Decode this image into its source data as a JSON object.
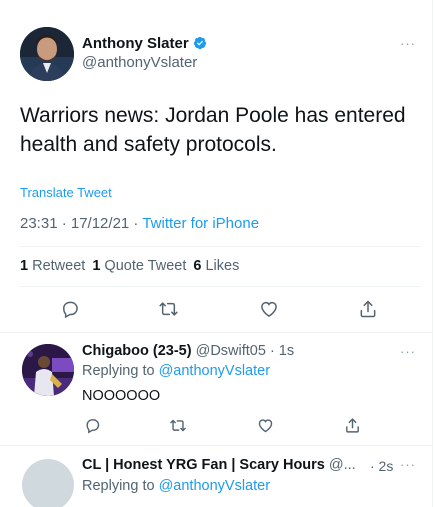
{
  "main_tweet": {
    "author_name": "Anthony Slater",
    "author_handle": "@anthonyVslater",
    "verified": true,
    "more_label": "···",
    "text": "Warriors news: Jordan Poole has entered health and safety protocols.",
    "translate_label": "Translate Tweet",
    "time": "23:31 · 17/12/21 · ",
    "source": "Twitter for iPhone",
    "stats": {
      "retweets_count": "1",
      "retweets_label": "Retweet",
      "quotes_count": "1",
      "quotes_label": "Quote Tweet",
      "likes_count": "6",
      "likes_label": "Likes"
    },
    "actions": [
      "reply-icon",
      "retweet-icon",
      "like-icon",
      "share-icon"
    ]
  },
  "replies": [
    {
      "name": "Chigaboo (23-5)",
      "handle": "@Dswift05",
      "time": "· 1s",
      "replying_prefix": "Replying to ",
      "replying_to": "@anthonyVslater",
      "text": "NOOOOOO",
      "more_label": "···"
    },
    {
      "name": "CL | Honest YRG Fan | Scary Hours",
      "handle": "@...",
      "time": "· 2s",
      "replying_prefix": "Replying to ",
      "replying_to": "@anthonyVslater",
      "more_label": "···"
    }
  ],
  "colors": {
    "accent": "#1d9bf0",
    "secondary_text": "#536471",
    "primary_text": "#0f1419",
    "border": "#eff3f4"
  }
}
